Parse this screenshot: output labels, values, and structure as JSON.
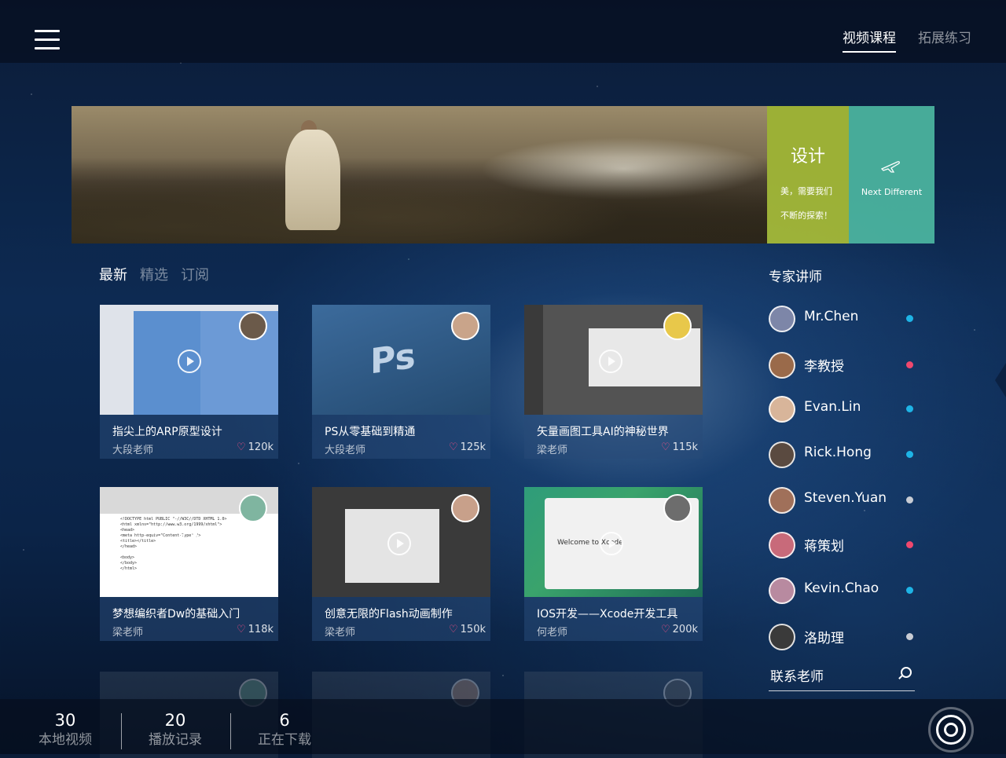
{
  "header": {
    "menu_icon": "hamburger-icon",
    "tabs": [
      {
        "label": "视频课程",
        "active": true
      },
      {
        "label": "拓展练习",
        "active": false
      }
    ]
  },
  "banner": {
    "design_title": "设计",
    "design_line1": "美，需要我们",
    "design_line2": "不断的探索！",
    "next_icon": "airplane-icon",
    "next_text": "Next   Different",
    "colors": {
      "design": "#B0C434",
      "next": "#50BEA5"
    }
  },
  "course_tabs": [
    {
      "label": "最新",
      "active": true
    },
    {
      "label": "精选",
      "active": false
    },
    {
      "label": "订阅",
      "active": false
    }
  ],
  "courses": [
    {
      "title": "指尖上的ARP原型设计",
      "teacher": "大段老师",
      "likes": "120k"
    },
    {
      "title": "PS从零基础到精通",
      "teacher": "大段老师",
      "likes": "125k"
    },
    {
      "title": "矢量画图工具AI的神秘世界",
      "teacher": "梁老师",
      "likes": "115k"
    },
    {
      "title": "梦想编织者Dw的基础入门",
      "teacher": "梁老师",
      "likes": "118k"
    },
    {
      "title": "创意无限的Flash动画制作",
      "teacher": "梁老师",
      "likes": "150k"
    },
    {
      "title": "IOS开发——Xcode开发工具",
      "teacher": "何老师",
      "likes": "200k"
    }
  ],
  "thumb_text": {
    "ps_logo": "Ps",
    "xcode_welcome": "Welcome to Xcode"
  },
  "experts": {
    "title": "专家讲师",
    "items": [
      {
        "name": "Mr.Chen",
        "status": "#1EB4E6"
      },
      {
        "name": "李教授",
        "status": "#F0486E"
      },
      {
        "name": "Evan.Lin",
        "status": "#1EB4E6"
      },
      {
        "name": "Rick.Hong",
        "status": "#1EB4E6"
      },
      {
        "name": "Steven.Yuan",
        "status": "#C8CCD4"
      },
      {
        "name": "蒋策划",
        "status": "#F0486E"
      },
      {
        "name": "Kevin.Chao",
        "status": "#1EB4E6"
      },
      {
        "name": "洛助理",
        "status": "#C8CCD4"
      }
    ],
    "contact_label": "联系老师",
    "contact_icon": "search-icon"
  },
  "bottom": {
    "stats": [
      {
        "value": "30",
        "label": "本地视频"
      },
      {
        "value": "20",
        "label": "播放记录"
      },
      {
        "value": "6",
        "label": "正在下载"
      }
    ],
    "action_icon": "record-ring-icon"
  }
}
